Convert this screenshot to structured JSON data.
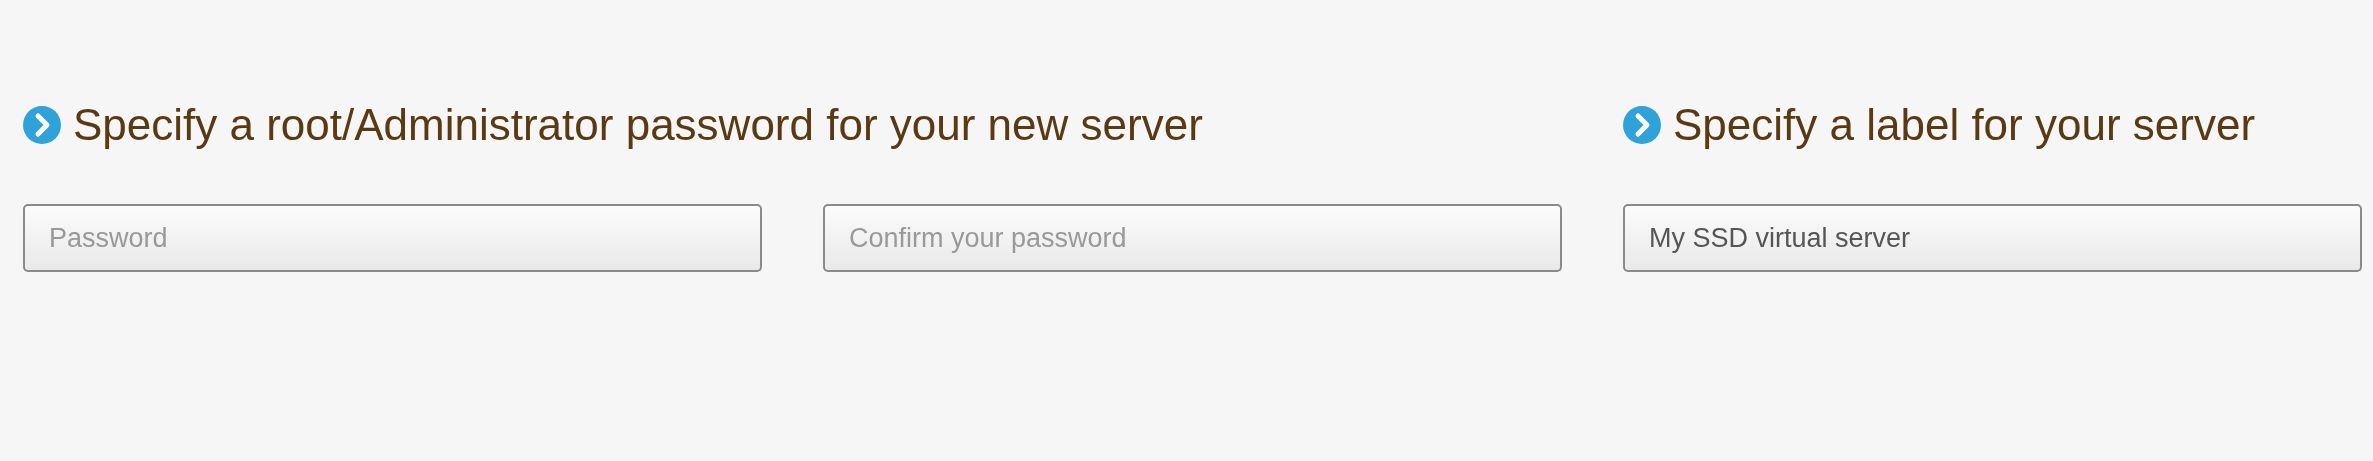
{
  "sections": [
    {
      "heading": "Specify a root/Administrator password for your new server",
      "fields": [
        {
          "placeholder": "Password"
        },
        {
          "placeholder": "Confirm your password"
        }
      ]
    },
    {
      "heading": "Specify a label for your server",
      "fields": [
        {
          "value": "My SSD virtual server"
        }
      ]
    }
  ]
}
